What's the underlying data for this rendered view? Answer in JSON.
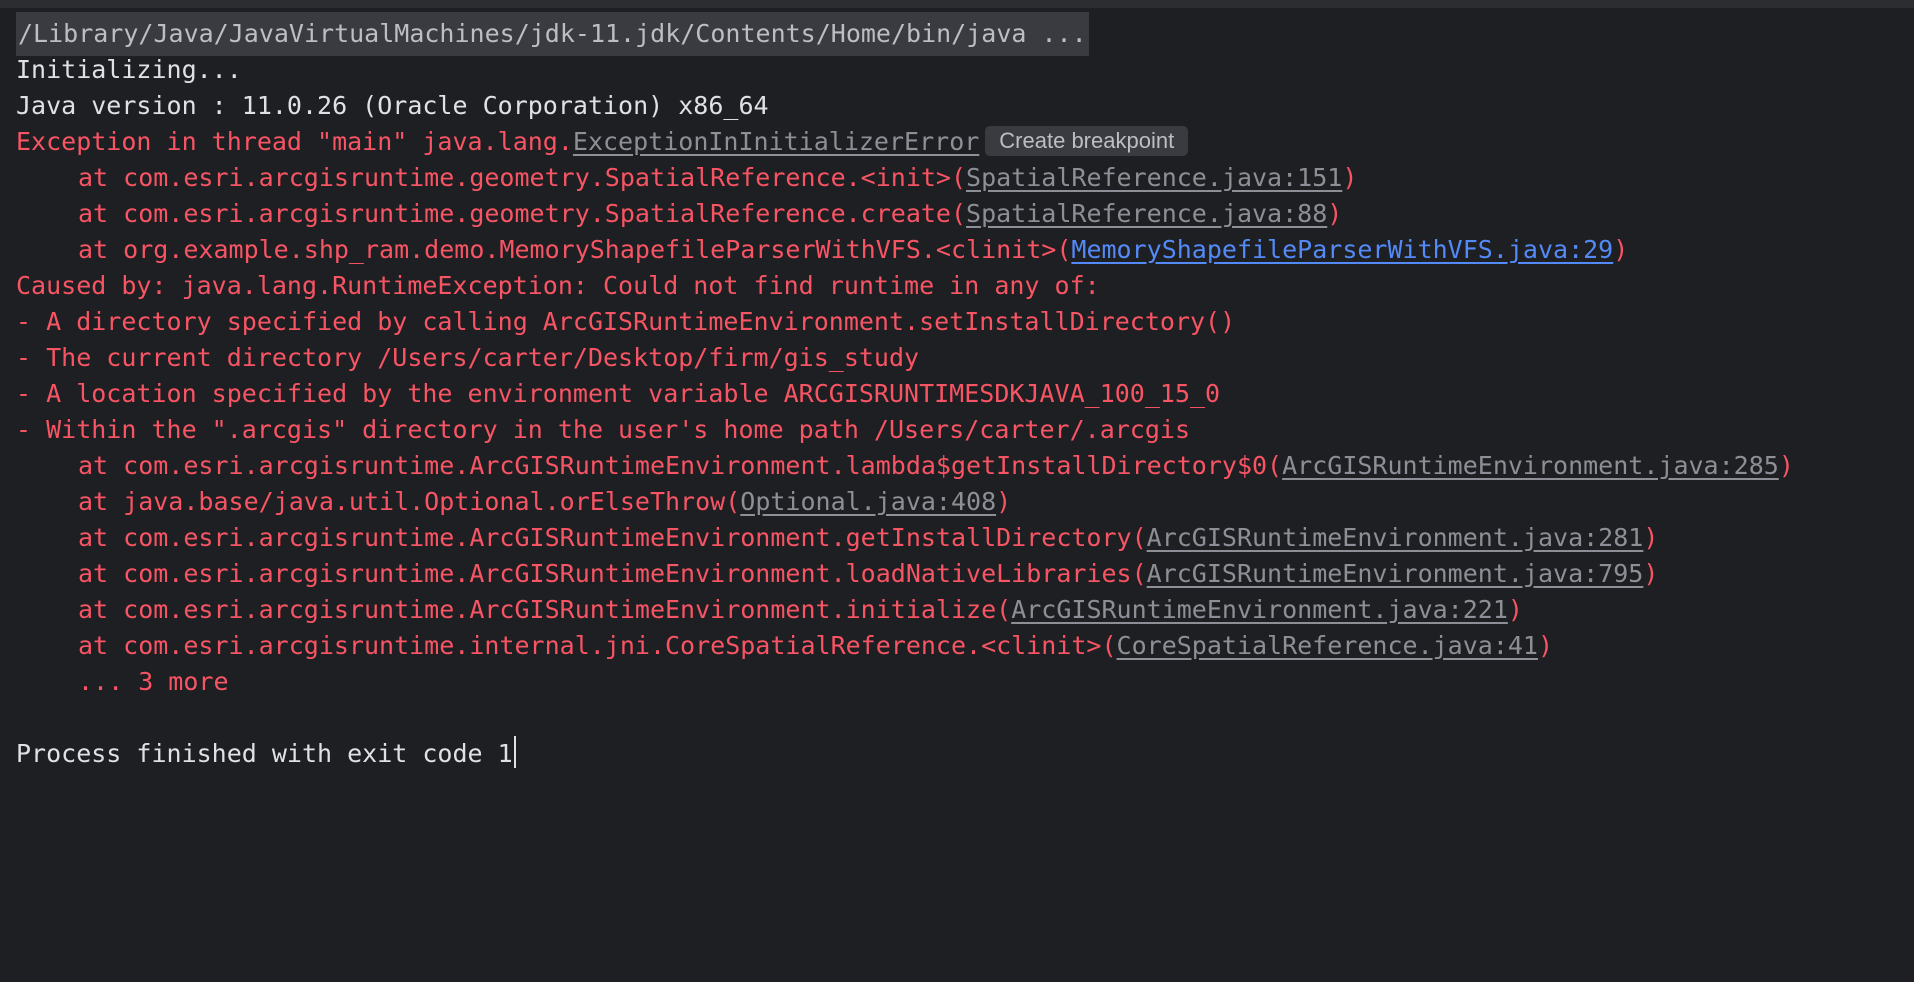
{
  "console": {
    "command": "/Library/Java/JavaVirtualMachines/jdk-11.jdk/Contents/Home/bin/java ...",
    "init": "Initializing...",
    "java_version": "Java version : 11.0.26 (Oracle Corporation) x86_64",
    "exception": {
      "prefix": "Exception in thread \"main\" java.lang.",
      "class_link": "ExceptionInInitializerError",
      "hint_button": "Create breakpoint"
    },
    "trace1": [
      {
        "at": "at com.esri.arcgisruntime.geometry.SpatialReference.<init>(",
        "link": "SpatialReference.java:151",
        "end": ")"
      },
      {
        "at": "at com.esri.arcgisruntime.geometry.SpatialReference.create(",
        "link": "SpatialReference.java:88",
        "end": ")"
      },
      {
        "at": "at org.example.shp_ram.demo.MemoryShapefileParserWithVFS.<clinit>(",
        "link": "MemoryShapefileParserWithVFS.java:29",
        "end": ")"
      }
    ],
    "caused_by": "Caused by: java.lang.RuntimeException: Could not find runtime in any of:",
    "bullets": [
      "- A directory specified by calling ArcGISRuntimeEnvironment.setInstallDirectory()",
      "- The current directory /Users/carter/Desktop/firm/gis_study",
      "- A location specified by the environment variable ARCGISRUNTIMESDKJAVA_100_15_0",
      "- Within the \".arcgis\" directory in the user's home path /Users/carter/.arcgis"
    ],
    "trace2": [
      {
        "at": "at com.esri.arcgisruntime.ArcGISRuntimeEnvironment.lambda$getInstallDirectory$0(",
        "link": "ArcGISRuntimeEnvironment.java:285",
        "end": ")"
      },
      {
        "at": "at java.base/java.util.Optional.orElseThrow(",
        "link": "Optional.java:408",
        "end": ")"
      },
      {
        "at": "at com.esri.arcgisruntime.ArcGISRuntimeEnvironment.getInstallDirectory(",
        "link": "ArcGISRuntimeEnvironment.java:281",
        "end": ")"
      },
      {
        "at": "at com.esri.arcgisruntime.ArcGISRuntimeEnvironment.loadNativeLibraries(",
        "link": "ArcGISRuntimeEnvironment.java:795",
        "end": ")"
      },
      {
        "at": "at com.esri.arcgisruntime.ArcGISRuntimeEnvironment.initialize(",
        "link": "ArcGISRuntimeEnvironment.java:221",
        "end": ")"
      },
      {
        "at": "at com.esri.arcgisruntime.internal.jni.CoreSpatialReference.<clinit>(",
        "link": "CoreSpatialReference.java:41",
        "end": ")"
      }
    ],
    "more": "... 3 more",
    "exit": "Process finished with exit code 1"
  },
  "colors": {
    "background": "#1e1f22",
    "error_text": "#f75464",
    "normal_text": "#dfe1e5",
    "source_link": "#8c8f96",
    "project_link": "#548af7"
  }
}
